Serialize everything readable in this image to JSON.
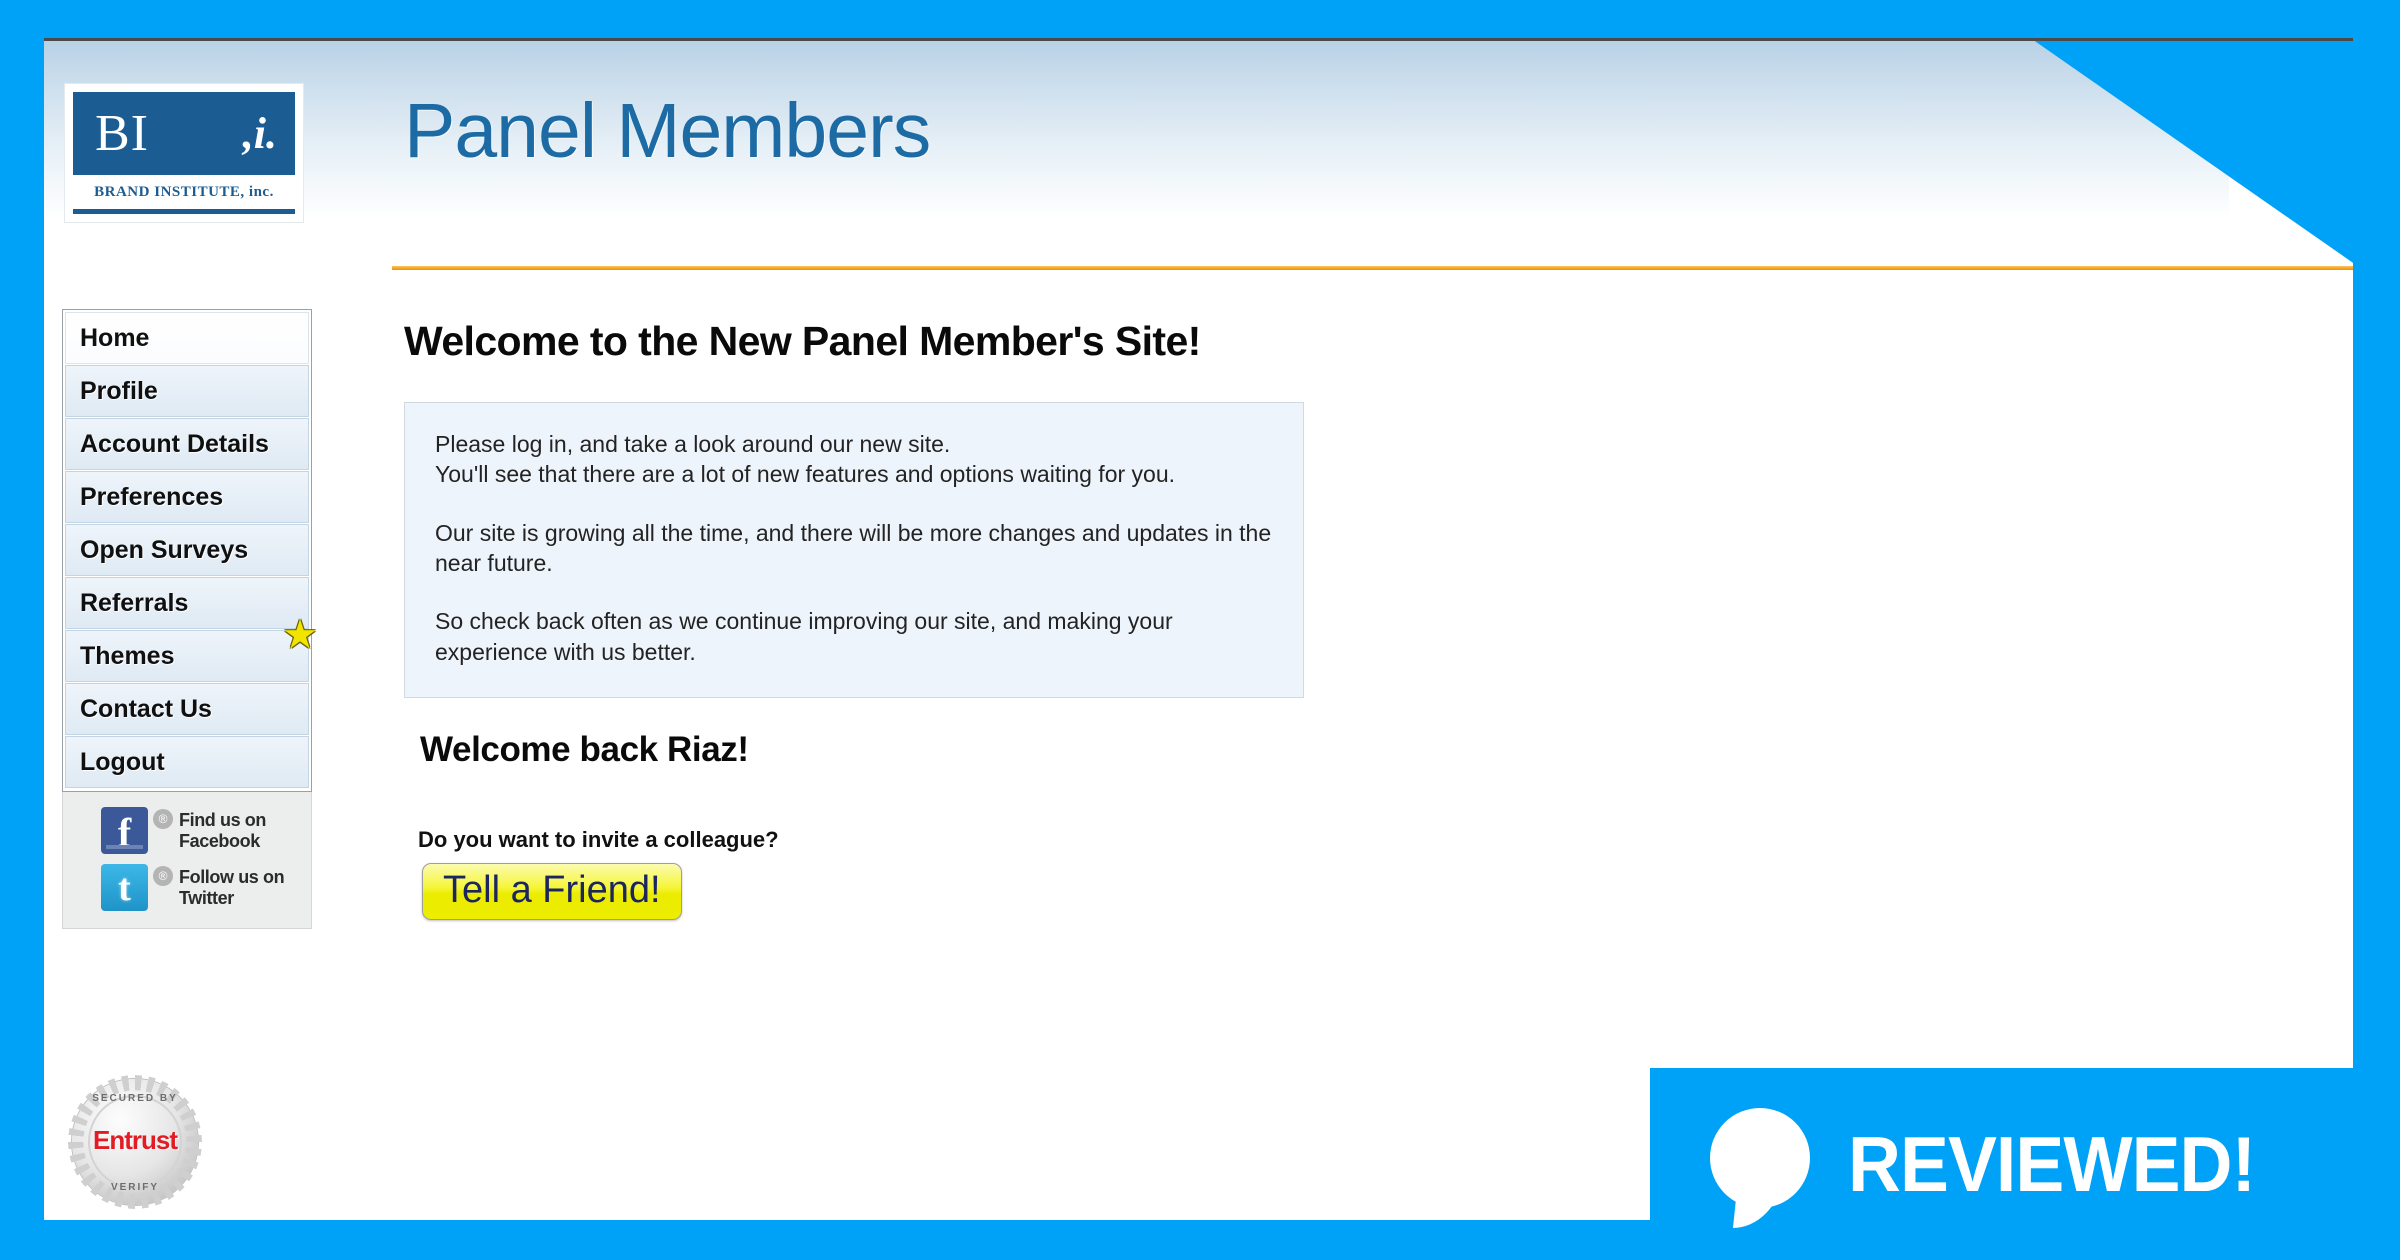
{
  "brand": {
    "logo_primary": "BI",
    "logo_secondary": ",i.",
    "logo_subtitle": "BRAND INSTITUTE, inc."
  },
  "header": {
    "title": "Panel Members",
    "accent_color": "#f5a623",
    "title_color": "#1d6ba4"
  },
  "sidebar": {
    "items": [
      {
        "label": "Home",
        "active": true,
        "badge": ""
      },
      {
        "label": "Profile",
        "active": false,
        "badge": ""
      },
      {
        "label": "Account Details",
        "active": false,
        "badge": ""
      },
      {
        "label": "Preferences",
        "active": false,
        "badge": ""
      },
      {
        "label": "Open Surveys",
        "active": false,
        "badge": ""
      },
      {
        "label": "Referrals",
        "active": false,
        "badge": ""
      },
      {
        "label": "Themes",
        "active": false,
        "badge": "star"
      },
      {
        "label": "Contact Us",
        "active": false,
        "badge": ""
      },
      {
        "label": "Logout",
        "active": false,
        "badge": ""
      }
    ],
    "social": [
      {
        "network": "facebook",
        "line1": "Find us on",
        "line2": "Facebook",
        "glyph": "f",
        "registered": "®"
      },
      {
        "network": "twitter",
        "line1": "Follow us on",
        "line2": "Twitter",
        "glyph": "t",
        "registered": "®"
      }
    ]
  },
  "main": {
    "heading": "Welcome to the New Panel Member's Site!",
    "info_paragraphs": [
      "Please log in, and take a look around our new site.\nYou'll see that there are a lot of new features and options waiting for you.",
      "Our site is growing all the time, and there will be more changes and updates in the near future.",
      "So check back often as we continue improving our site, and making your experience with us better."
    ],
    "welcome_back": "Welcome back Riaz!",
    "invite_question": "Do you want to invite a colleague?",
    "tell_friend_label": "Tell a Friend!"
  },
  "footer": {
    "seal": {
      "top_arc": "SECURED BY",
      "word": "Entrust",
      "bottom_arc": "VERIFY"
    },
    "watermark": {
      "text": "REVIEWED!",
      "background": "#00a2f8"
    }
  }
}
